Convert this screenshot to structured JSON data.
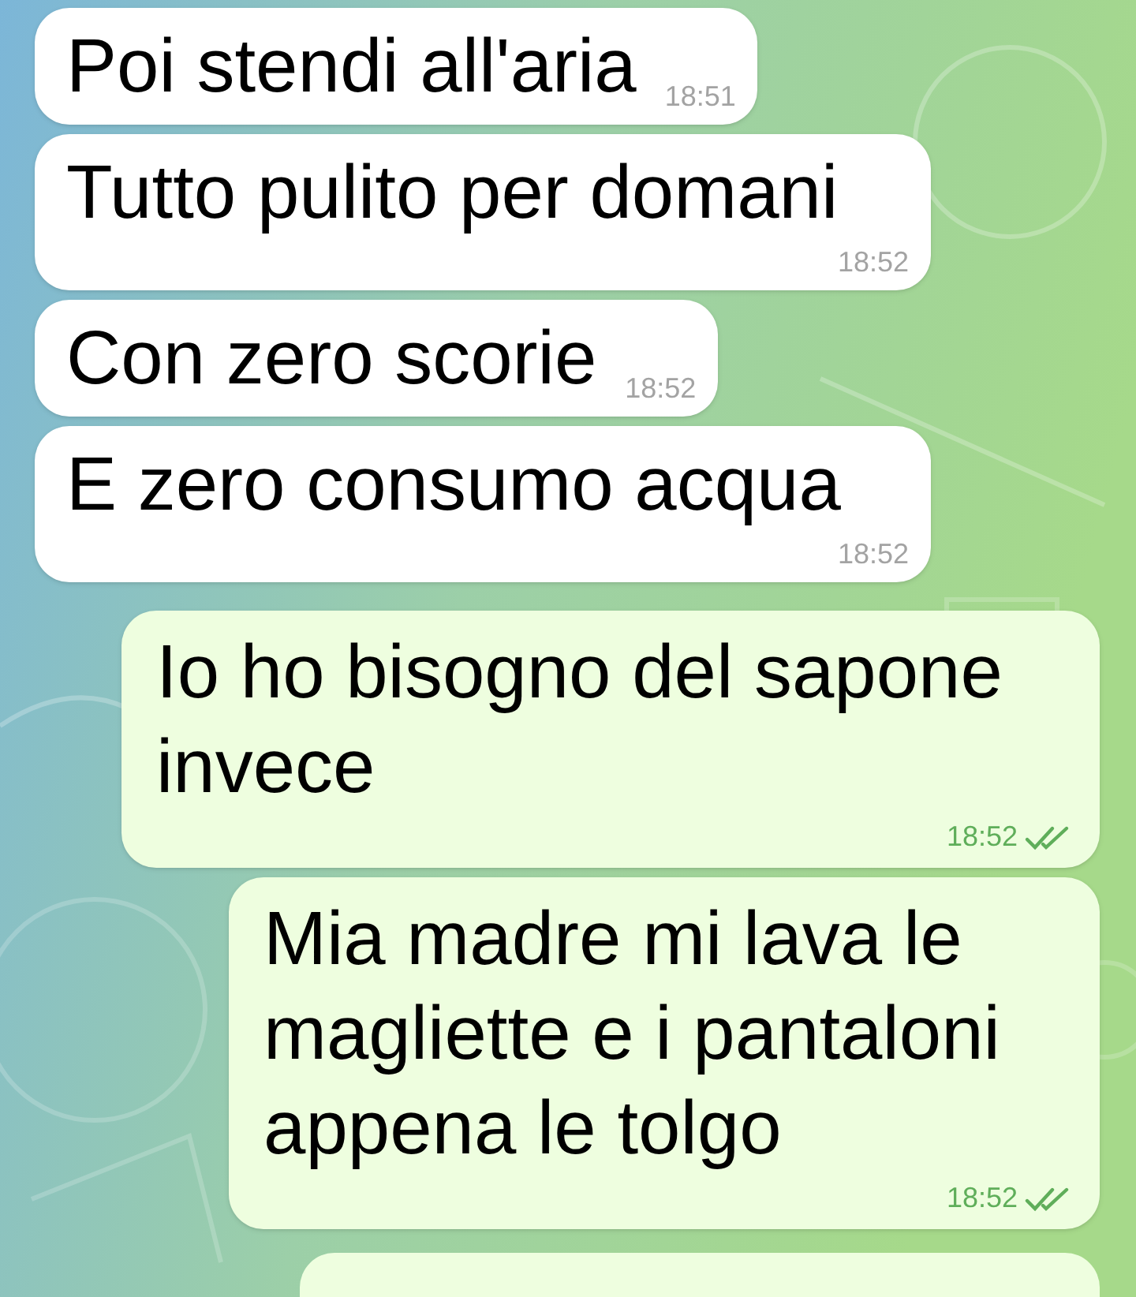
{
  "messages": [
    {
      "text": "Poi stendi all'aria",
      "time": "18:51",
      "outgoing": false
    },
    {
      "text": "Tutto pulito per domani",
      "time": "18:52",
      "outgoing": false
    },
    {
      "text": "Con zero scorie",
      "time": "18:52",
      "outgoing": false
    },
    {
      "text": "E zero consumo acqua",
      "time": "18:52",
      "outgoing": false
    },
    {
      "text": "Io ho bisogno del sapone invece",
      "time": "18:52",
      "outgoing": true,
      "read": true
    },
    {
      "text": "Mia madre mi lava le magliette e i pantaloni appena le tolgo",
      "time": "18:52",
      "outgoing": true,
      "read": true
    }
  ]
}
